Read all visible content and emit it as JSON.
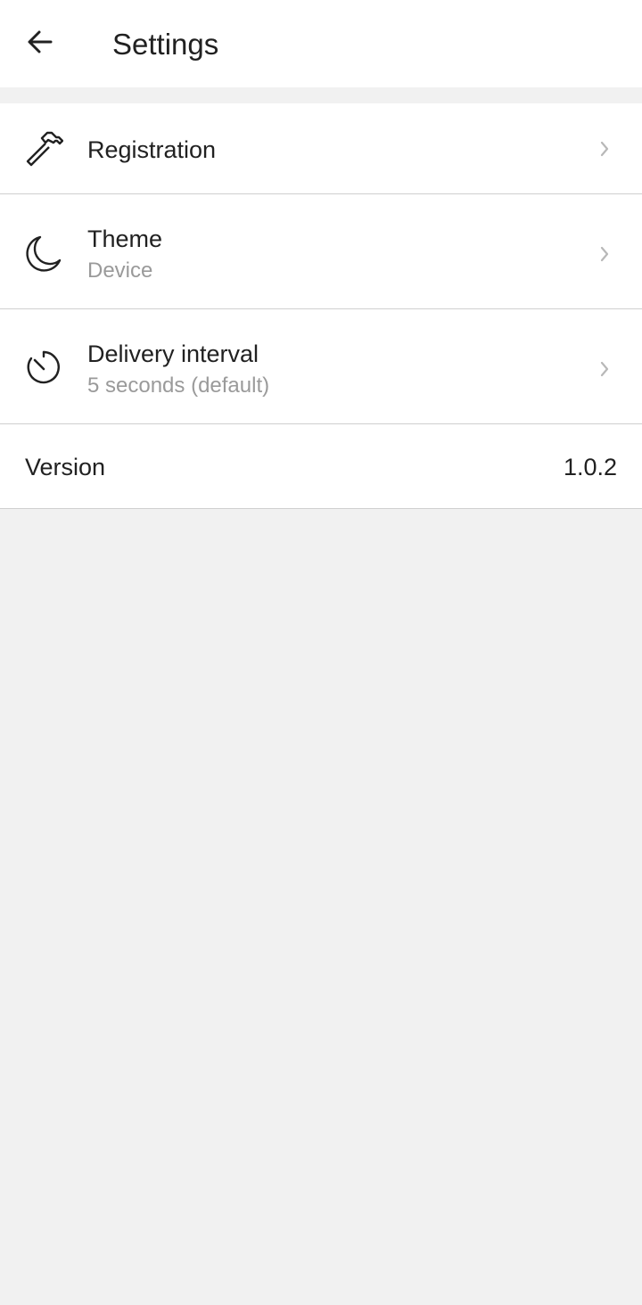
{
  "header": {
    "title": "Settings",
    "back_icon": "arrow-left-icon"
  },
  "settings": {
    "registration": {
      "label": "Registration",
      "icon": "hammer-icon"
    },
    "theme": {
      "label": "Theme",
      "value": "Device",
      "icon": "moon-icon"
    },
    "delivery_interval": {
      "label": "Delivery interval",
      "value": "5 seconds (default)",
      "icon": "timer-icon"
    },
    "version": {
      "label": "Version",
      "value": "1.0.2"
    }
  },
  "colors": {
    "surface": "#ffffff",
    "background": "#f1f1f1",
    "text_primary": "#212121",
    "text_secondary": "#9a9a9a",
    "divider": "#cfcfcf"
  }
}
